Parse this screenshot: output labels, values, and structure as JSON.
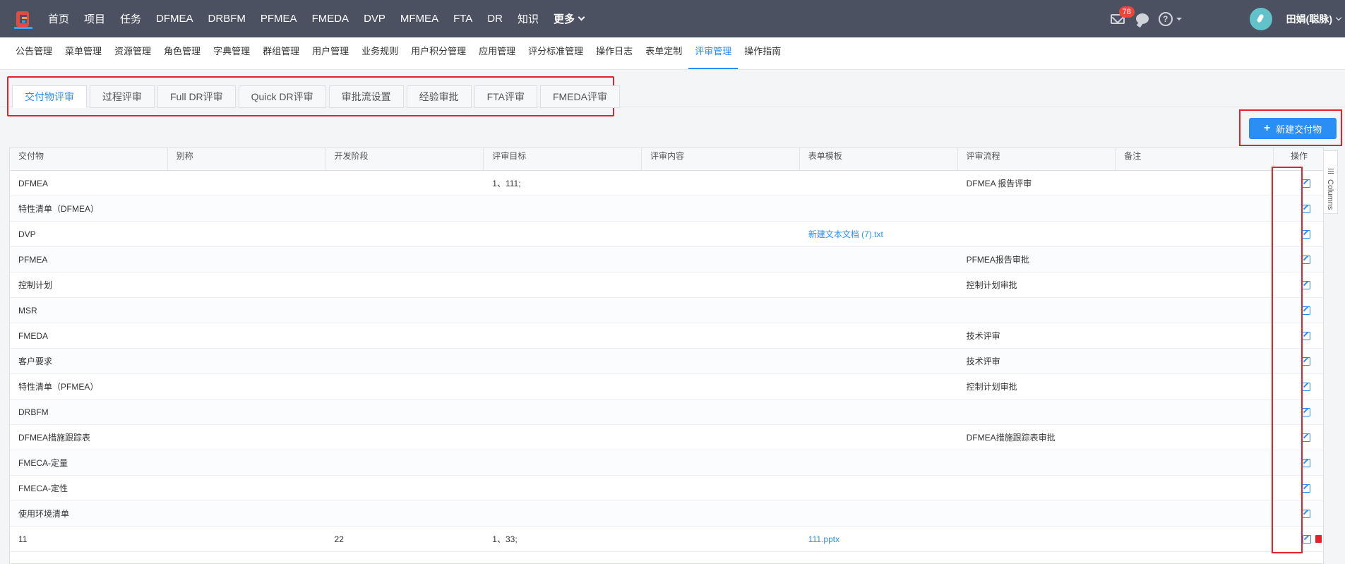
{
  "topnav": {
    "items": [
      "首页",
      "项目",
      "任务",
      "DFMEA",
      "DRBFM",
      "PFMEA",
      "FMEDA",
      "DVP",
      "MFMEA",
      "FTA",
      "DR",
      "知识"
    ],
    "more_label": "更多",
    "mail_badge": "78",
    "help_glyph": "?",
    "username": "田娟(聪脉)"
  },
  "submenu": {
    "items": [
      "公告管理",
      "菜单管理",
      "资源管理",
      "角色管理",
      "字典管理",
      "群组管理",
      "用户管理",
      "业务规则",
      "用户积分管理",
      "应用管理",
      "评分标准管理",
      "操作日志",
      "表单定制",
      "评审管理",
      "操作指南"
    ],
    "active_index": 13
  },
  "tabs": {
    "items": [
      "交付物评审",
      "过程评审",
      "Full DR评审",
      "Quick DR评审",
      "审批流设置",
      "经验审批",
      "FTA评审",
      "FMEDA评审"
    ],
    "active_index": 0
  },
  "toolbar": {
    "new_label": "新建交付物",
    "plus": "+"
  },
  "table": {
    "headers": [
      "交付物",
      "别称",
      "开发阶段",
      "评审目标",
      "评审内容",
      "表单模板",
      "评审流程",
      "备注",
      "操作"
    ],
    "rows": [
      [
        "DFMEA",
        "",
        "",
        "1、111;",
        "",
        "",
        "DFMEA 报告评审",
        ""
      ],
      [
        "特性清单（DFMEA）",
        "",
        "",
        "",
        "",
        "",
        "",
        ""
      ],
      [
        "DVP",
        "",
        "",
        "",
        "",
        "新建文本文档 (7).txt",
        "",
        ""
      ],
      [
        "PFMEA",
        "",
        "",
        "",
        "",
        "",
        "PFMEA报告审批",
        ""
      ],
      [
        "控制计划",
        "",
        "",
        "",
        "",
        "",
        "控制计划审批",
        ""
      ],
      [
        "MSR",
        "",
        "",
        "",
        "",
        "",
        "",
        ""
      ],
      [
        "FMEDA",
        "",
        "",
        "",
        "",
        "",
        "技术评审",
        ""
      ],
      [
        "客户要求",
        "",
        "",
        "",
        "",
        "",
        "技术评审",
        ""
      ],
      [
        "特性清单（PFMEA）",
        "",
        "",
        "",
        "",
        "",
        "控制计划审批",
        ""
      ],
      [
        "DRBFM",
        "",
        "",
        "",
        "",
        "",
        "",
        ""
      ],
      [
        "DFMEA措施跟踪表",
        "",
        "",
        "",
        "",
        "",
        "DFMEA措施跟踪表审批",
        ""
      ],
      [
        "FMECA-定量",
        "",
        "",
        "",
        "",
        "",
        "",
        ""
      ],
      [
        "FMECA-定性",
        "",
        "",
        "",
        "",
        "",
        "",
        ""
      ],
      [
        "使用环境清单",
        "",
        "",
        "",
        "",
        "",
        "",
        ""
      ],
      [
        "11",
        "",
        "22",
        "1、33;",
        "",
        "111.pptx",
        "",
        ""
      ]
    ]
  },
  "columns_tool": {
    "label": "Columns"
  },
  "colors": {
    "accent": "#2a8ef5",
    "nav_bg": "#4b5160",
    "highlight": "#e8202a"
  }
}
